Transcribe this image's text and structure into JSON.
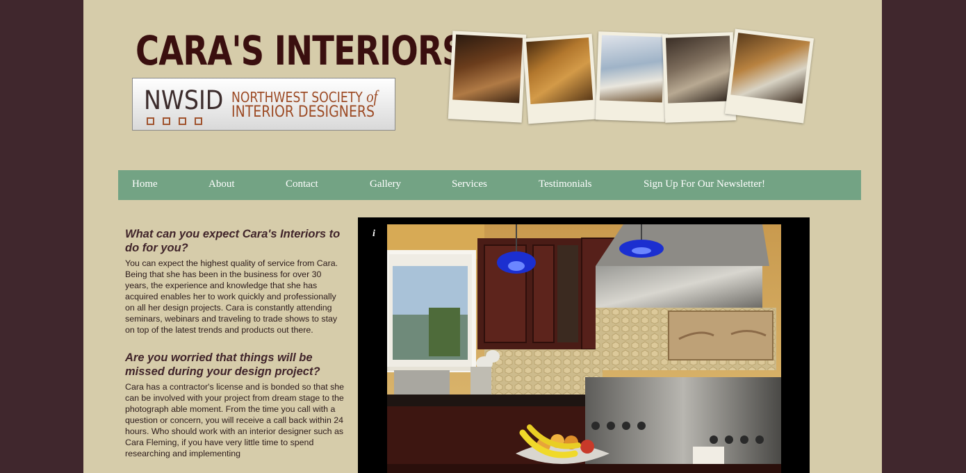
{
  "header": {
    "title": "CARA'S INTERIORS",
    "badge": {
      "abbr": "NWSID",
      "line1_a": "NORTHWEST SOCIETY",
      "line1_b": "of",
      "line2": "INTERIOR DESIGNERS"
    },
    "photo_strip_count": 5
  },
  "nav": {
    "items": [
      {
        "label": "Home"
      },
      {
        "label": "About"
      },
      {
        "label": "Contact"
      },
      {
        "label": "Gallery"
      },
      {
        "label": "Services"
      },
      {
        "label": "Testimonials"
      },
      {
        "label": "Sign Up For Our Newsletter!"
      }
    ]
  },
  "main": {
    "sections": [
      {
        "heading": "What can you expect Cara's Interiors to do for you?",
        "body": "You can expect the highest quality of service from Cara. Being that she has been in the business for over 30 years, the experience and knowledge that she has acquired enables her to work quickly and professionally on all her design projects. Cara is constantly attending seminars, webinars and traveling to trade shows to stay on top of the latest trends and products out there."
      },
      {
        "heading": "Are you worried that things will be missed during your design project?",
        "body": "Cara has a contractor's license and is bonded so that she can be involved with your project from dream stage to the photograph able moment. From the time you call with a question or concern, you will receive a call back within 24 hours. Who should work with an interior designer such as Cara Fleming, if you have very little time to spend researching and implementing"
      }
    ]
  },
  "slideshow": {
    "info_label": "i"
  },
  "colors": {
    "outer_bg": "#40272d",
    "page_bg": "#d6ccaa",
    "nav_bg": "#73a384",
    "title": "#3a0f0f",
    "heading": "#40242a"
  }
}
